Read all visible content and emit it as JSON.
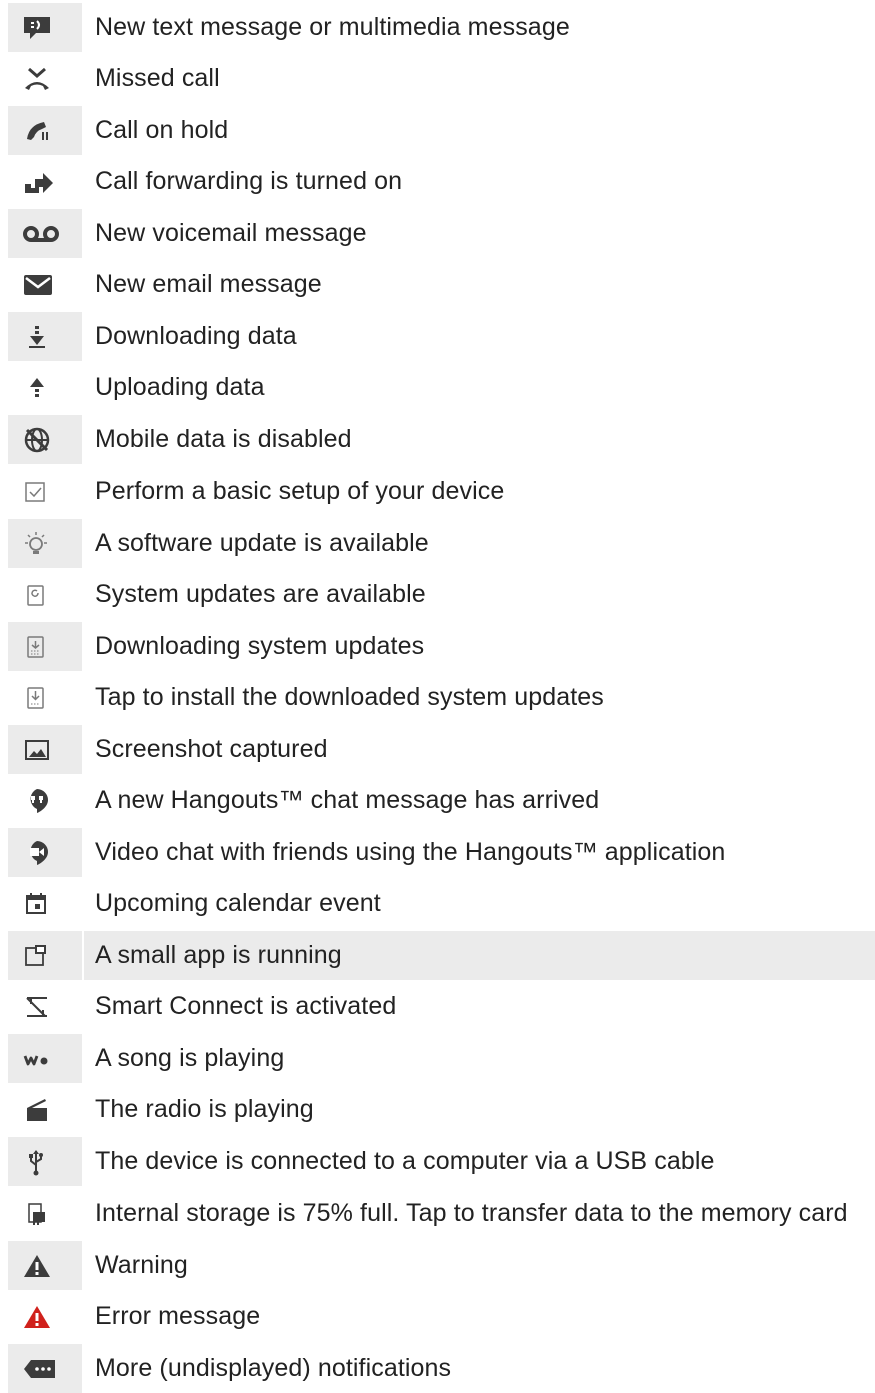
{
  "items": [
    {
      "label": "New text message or multimedia message",
      "icon": "sms-icon",
      "shaded_icon": true,
      "shaded_text": false
    },
    {
      "label": "Missed call",
      "icon": "missed-call-icon",
      "shaded_icon": false,
      "shaded_text": false
    },
    {
      "label": "Call on hold",
      "icon": "call-on-hold-icon",
      "shaded_icon": true,
      "shaded_text": false
    },
    {
      "label": "Call forwarding is turned on",
      "icon": "call-forward-icon",
      "shaded_icon": false,
      "shaded_text": false
    },
    {
      "label": "New voicemail message",
      "icon": "voicemail-icon",
      "shaded_icon": true,
      "shaded_text": false
    },
    {
      "label": "New email message",
      "icon": "email-icon",
      "shaded_icon": false,
      "shaded_text": false
    },
    {
      "label": "Downloading data",
      "icon": "download-icon",
      "shaded_icon": true,
      "shaded_text": false
    },
    {
      "label": "Uploading data",
      "icon": "upload-icon",
      "shaded_icon": false,
      "shaded_text": false
    },
    {
      "label": "Mobile data is disabled",
      "icon": "mobile-data-disabled-icon",
      "shaded_icon": true,
      "shaded_text": false
    },
    {
      "label": "Perform a basic setup of your device",
      "icon": "checkbox-icon",
      "shaded_icon": false,
      "shaded_text": false
    },
    {
      "label": "A software update is available",
      "icon": "lightbulb-icon",
      "shaded_icon": true,
      "shaded_text": false
    },
    {
      "label": "System updates are available",
      "icon": "system-update-icon",
      "shaded_icon": false,
      "shaded_text": false
    },
    {
      "label": "Downloading system updates",
      "icon": "system-update-download-icon",
      "shaded_icon": true,
      "shaded_text": false
    },
    {
      "label": "Tap to install the downloaded system updates",
      "icon": "system-update-install-icon",
      "shaded_icon": false,
      "shaded_text": false
    },
    {
      "label": "Screenshot captured",
      "icon": "screenshot-icon",
      "shaded_icon": true,
      "shaded_text": false
    },
    {
      "label": "A new Hangouts™ chat message has arrived",
      "icon": "hangouts-chat-icon",
      "shaded_icon": false,
      "shaded_text": false
    },
    {
      "label": "Video chat with friends using the Hangouts™ application",
      "icon": "hangouts-video-icon",
      "shaded_icon": true,
      "shaded_text": false
    },
    {
      "label": "Upcoming calendar event",
      "icon": "calendar-icon",
      "shaded_icon": false,
      "shaded_text": false
    },
    {
      "label": "A small app is running",
      "icon": "small-app-icon",
      "shaded_icon": true,
      "shaded_text": true
    },
    {
      "label": "Smart Connect is activated",
      "icon": "smart-connect-icon",
      "shaded_icon": false,
      "shaded_text": false
    },
    {
      "label": "A song is playing",
      "icon": "walkman-icon",
      "shaded_icon": true,
      "shaded_text": false
    },
    {
      "label": "The radio is playing",
      "icon": "radio-icon",
      "shaded_icon": false,
      "shaded_text": false
    },
    {
      "label": "The device is connected to a computer via a USB cable",
      "icon": "usb-icon",
      "shaded_icon": true,
      "shaded_text": false
    },
    {
      "label": "Internal storage is 75% full. Tap to transfer data to the memory card",
      "icon": "storage-icon",
      "shaded_icon": false,
      "shaded_text": false
    },
    {
      "label": "Warning",
      "icon": "warning-icon",
      "shaded_icon": true,
      "shaded_text": false
    },
    {
      "label": "Error message",
      "icon": "error-icon",
      "shaded_icon": false,
      "shaded_text": false
    },
    {
      "label": "More (undisplayed) notifications",
      "icon": "more-notifications-icon",
      "shaded_icon": true,
      "shaded_text": false
    }
  ],
  "colors": {
    "icon": "#3c3c3c",
    "icon_light": "#7a7a7a",
    "error": "#d0211c",
    "shade": "#ebebeb",
    "text": "#222222"
  }
}
